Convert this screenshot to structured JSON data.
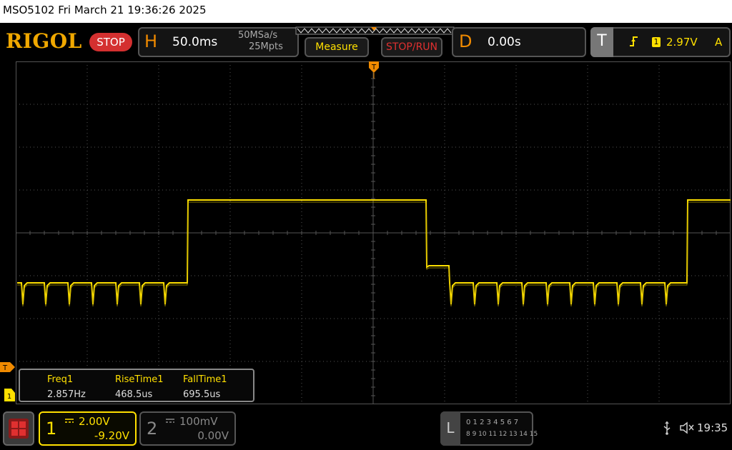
{
  "titlebar": {
    "text": "MSO5102  Fri March 21 19:36:26 2025"
  },
  "toolbar": {
    "logo": "RIGOL",
    "status": "STOP",
    "horizontal": {
      "letter": "H",
      "timebase": "50.0ms",
      "sample_rate": "50MSa/s",
      "memory_depth": "25Mpts"
    },
    "measure_label": "Measure",
    "stoprun_label": "STOP/RUN",
    "delay": {
      "letter": "D",
      "value": "0.00s"
    },
    "trigger": {
      "letter": "T",
      "source_badge": "1",
      "level": "2.97V",
      "mode": "A"
    }
  },
  "screen": {
    "trigger_top_marker": "T",
    "left_trigger_marker": "T",
    "channel_marker": "1"
  },
  "measurements": [
    {
      "label": "Freq1",
      "value": "2.857Hz"
    },
    {
      "label": "RiseTime1",
      "value": "468.5us"
    },
    {
      "label": "FallTime1",
      "value": "695.5us"
    }
  ],
  "bottom": {
    "ch1": {
      "number": "1",
      "scale": "2.00V",
      "offset": "-9.20V"
    },
    "ch2": {
      "number": "2",
      "scale": "100mV",
      "offset": "0.00V"
    },
    "logic": {
      "letter": "L",
      "row1": "0 1 2 3  4 5 6 7",
      "row2": "8 9 10 11 12 13 14 15"
    },
    "time": "19:35"
  },
  "colors": {
    "ch1": "#ffe000",
    "accent": "#f08a00",
    "stop": "#d43030",
    "grid": "#555555"
  }
}
